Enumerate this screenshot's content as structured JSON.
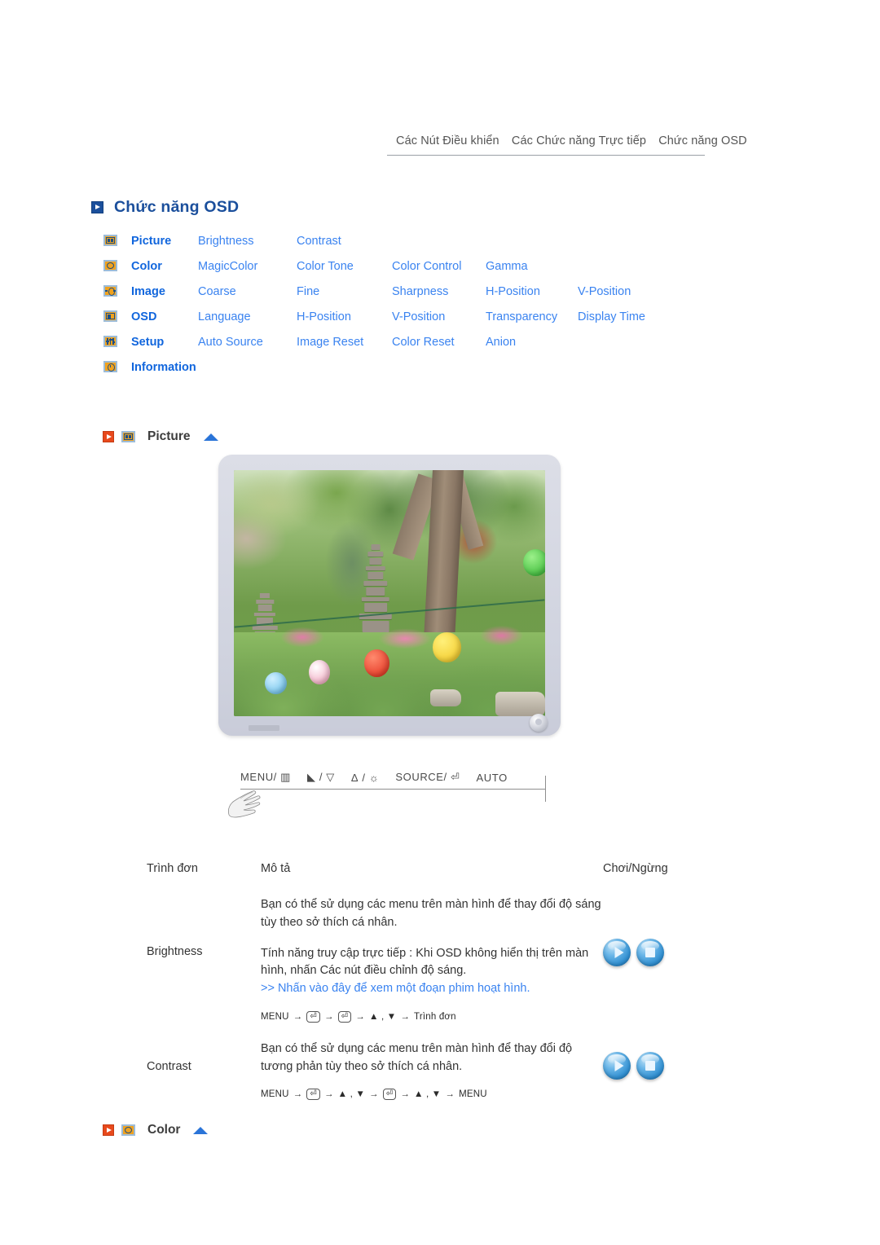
{
  "topnav": {
    "items": [
      "Các Nút Điều khiển",
      "Các Chức năng Trực tiếp",
      "Chức năng OSD"
    ]
  },
  "page": {
    "title": "Chức năng OSD",
    "title_icon": "play-square-icon"
  },
  "menu_matrix": {
    "rows": [
      {
        "icon": "picture-icon",
        "category": "Picture",
        "items": [
          "Brightness",
          "Contrast",
          "",
          "",
          ""
        ]
      },
      {
        "icon": "color-icon",
        "category": "Color",
        "items": [
          "MagicColor",
          "Color Tone",
          "Color Control",
          "Gamma",
          ""
        ]
      },
      {
        "icon": "image-icon",
        "category": "Image",
        "items": [
          "Coarse",
          "Fine",
          "Sharpness",
          "H-Position",
          "V-Position"
        ]
      },
      {
        "icon": "osd-icon",
        "category": "OSD",
        "items": [
          "Language",
          "H-Position",
          "V-Position",
          "Transparency",
          "Display Time"
        ]
      },
      {
        "icon": "setup-icon",
        "category": "Setup",
        "items": [
          "Auto Source",
          "Image Reset",
          "Color Reset",
          "Anion",
          ""
        ]
      },
      {
        "icon": "information-icon",
        "category": "Information",
        "items": [
          "",
          "",
          "",
          "",
          ""
        ]
      }
    ]
  },
  "sections": {
    "picture": {
      "label": "Picture",
      "play_icon": "red-play-icon",
      "menu_icon": "picture-icon",
      "collapse_icon": "triangle-up-icon"
    },
    "color": {
      "label": "Color",
      "play_icon": "red-play-icon",
      "menu_icon": "color-icon",
      "collapse_icon": "triangle-up-icon"
    }
  },
  "monitor": {
    "alt": "Màn hình hiển thị ảnh vườn Hàn Quốc với tháp đá và đèn lồng",
    "controls": [
      "MENU/",
      "/",
      "/",
      "SOURCE/",
      "AUTO"
    ],
    "control_labels": {
      "menu": "MENU/",
      "menu_glyph": "▥",
      "brightness": "/",
      "brightness_glyph_left": "◣",
      "brightness_glyph_right": "▽",
      "adjust": "/",
      "adjust_glyph_left": "Δ",
      "adjust_glyph_right": "☼",
      "source": "SOURCE/",
      "source_glyph": "⏎",
      "auto": "AUTO"
    }
  },
  "table": {
    "headers": {
      "menu": "Trình đơn",
      "description": "Mô tả",
      "play": "Chơi/Ngừng"
    },
    "rows": [
      {
        "name": "Brightness",
        "paragraphs": [
          "Bạn có thể sử dụng các menu trên màn hình để thay đổi độ sáng tùy theo sở thích cá nhân.",
          "Tính năng truy cập trực tiếp : Khi OSD không hiển thị trên màn hình, nhấn Các nút điều chỉnh độ sáng."
        ],
        "link": ">> Nhấn vào đây để xem một đoạn phim hoạt hình.",
        "sequence": [
          "MENU",
          "→",
          "⏎",
          "→",
          "⏎",
          "→",
          "▲ , ▼",
          "→",
          "Trình đơn"
        ],
        "play_label": "play-button",
        "stop_label": "stop-button"
      },
      {
        "name": "Contrast",
        "paragraphs": [
          "Bạn có thể sử dụng các menu trên màn hình để thay đổi độ tương phản tùy theo sở thích cá nhân."
        ],
        "link": "",
        "sequence": [
          "MENU",
          "→",
          "⏎",
          "→",
          "▲ , ▼",
          "→",
          "⏎",
          "→",
          "▲ , ▼",
          "→",
          "MENU"
        ],
        "play_label": "play-button",
        "stop_label": "stop-button"
      }
    ]
  },
  "colors": {
    "title_blue": "#1b4f9c",
    "link_blue": "#3a83f0",
    "category_blue": "#1166dd",
    "icon_gold": "#f0a21e",
    "icon_border": "#9dbcd8",
    "red_play": "#e8491c",
    "triangle_blue": "#2a74d8",
    "button_blue": "#2f8ed0"
  }
}
